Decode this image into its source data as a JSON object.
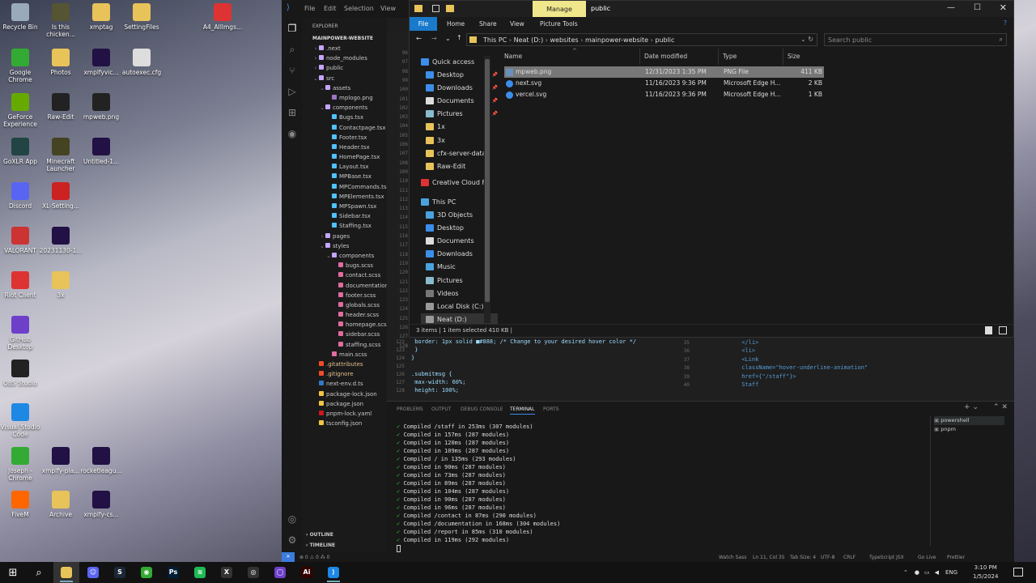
{
  "desktop": {
    "icons": [
      {
        "label": "Recycle Bin",
        "color": "#9ab"
      },
      {
        "label": "Is this chicken...",
        "color": "#553"
      },
      {
        "label": "xmptag",
        "color": "#e8c35a"
      },
      {
        "label": "SettingFiles",
        "color": "#e8c35a"
      },
      {
        "label": "A4_AllImgs...",
        "color": "#d33"
      },
      {
        "label": "Google Chrome",
        "color": "#3a3"
      },
      {
        "label": "Photos",
        "color": "#e8c35a"
      },
      {
        "label": "xmplfyvic...",
        "color": "#214"
      },
      {
        "label": "autoexec.cfg",
        "color": "#ddd"
      },
      {
        "label": "GeForce Experience",
        "color": "#6a0"
      },
      {
        "label": "Raw-Edit",
        "color": "#222"
      },
      {
        "label": "mpweb.png",
        "color": "#222"
      },
      {
        "label": "GoXLR App",
        "color": "#244"
      },
      {
        "label": "Minecraft Launcher",
        "color": "#442"
      },
      {
        "label": "Untitled-1...",
        "color": "#214"
      },
      {
        "label": "Discord",
        "color": "#5865f2"
      },
      {
        "label": "XL-Setting...",
        "color": "#c22"
      },
      {
        "label": "VALORANT",
        "color": "#c33"
      },
      {
        "label": "20231130-1...",
        "color": "#214"
      },
      {
        "label": "Riot Client",
        "color": "#d33"
      },
      {
        "label": "3x",
        "color": "#e8c35a"
      },
      {
        "label": "GitHub Desktop",
        "color": "#6e40c9"
      },
      {
        "label": "OBS Studio",
        "color": "#222"
      },
      {
        "label": "Visual Studio Code",
        "color": "#1e88e5"
      },
      {
        "label": "Joseph - Chrome",
        "color": "#3a3"
      },
      {
        "label": "xmplfy-pla...",
        "color": "#214"
      },
      {
        "label": "rocketleagu...",
        "color": "#214"
      },
      {
        "label": "FiveM",
        "color": "#f60"
      },
      {
        "label": "Archive",
        "color": "#e8c35a"
      },
      {
        "label": "xmplfy-cs...",
        "color": "#214"
      }
    ]
  },
  "vscode": {
    "menu": [
      "File",
      "Edit",
      "Selection",
      "View"
    ],
    "explorer_title": "EXPLORER",
    "root": "MAINPOWER-WEBSITE",
    "tree": [
      {
        "label": ".next",
        "depth": 1,
        "kind": "folder"
      },
      {
        "label": "node_modules",
        "depth": 1,
        "kind": "folder"
      },
      {
        "label": "public",
        "depth": 1,
        "kind": "folder"
      },
      {
        "label": "src",
        "depth": 1,
        "kind": "folder-open"
      },
      {
        "label": "assets",
        "depth": 2,
        "kind": "folder-open"
      },
      {
        "label": "mplogo.png",
        "depth": 3,
        "kind": "img"
      },
      {
        "label": "components",
        "depth": 2,
        "kind": "folder-open"
      },
      {
        "label": "Bugs.tsx",
        "depth": 3,
        "kind": "tsx"
      },
      {
        "label": "Contactpage.tsx",
        "depth": 3,
        "kind": "tsx"
      },
      {
        "label": "Footer.tsx",
        "depth": 3,
        "kind": "tsx"
      },
      {
        "label": "Header.tsx",
        "depth": 3,
        "kind": "tsx"
      },
      {
        "label": "HomePage.tsx",
        "depth": 3,
        "kind": "tsx"
      },
      {
        "label": "Layout.tsx",
        "depth": 3,
        "kind": "tsx"
      },
      {
        "label": "MPBase.tsx",
        "depth": 3,
        "kind": "tsx"
      },
      {
        "label": "MPCommands.tsx",
        "depth": 3,
        "kind": "tsx"
      },
      {
        "label": "MPElements.tsx",
        "depth": 3,
        "kind": "tsx"
      },
      {
        "label": "MPSpawn.tsx",
        "depth": 3,
        "kind": "tsx"
      },
      {
        "label": "Sidebar.tsx",
        "depth": 3,
        "kind": "tsx"
      },
      {
        "label": "Staffing.tsx",
        "depth": 3,
        "kind": "tsx"
      },
      {
        "label": "pages",
        "depth": 2,
        "kind": "folder"
      },
      {
        "label": "styles",
        "depth": 2,
        "kind": "folder-open"
      },
      {
        "label": "components",
        "depth": 3,
        "kind": "folder-open"
      },
      {
        "label": "bugs.scss",
        "depth": 4,
        "kind": "scss"
      },
      {
        "label": "contact.scss",
        "depth": 4,
        "kind": "scss"
      },
      {
        "label": "documentation.s...",
        "depth": 4,
        "kind": "scss"
      },
      {
        "label": "footer.scss",
        "depth": 4,
        "kind": "scss"
      },
      {
        "label": "globals.scss",
        "depth": 4,
        "kind": "scss"
      },
      {
        "label": "header.scss",
        "depth": 4,
        "kind": "scss"
      },
      {
        "label": "homepage.scss",
        "depth": 4,
        "kind": "scss"
      },
      {
        "label": "sidebar.scss",
        "depth": 4,
        "kind": "scss"
      },
      {
        "label": "staffing.scss",
        "depth": 4,
        "kind": "scss"
      },
      {
        "label": "main.scss",
        "depth": 3,
        "kind": "scss"
      },
      {
        "label": ".gitattributes",
        "depth": 1,
        "kind": "git"
      },
      {
        "label": ".gitignore",
        "depth": 1,
        "kind": "git"
      },
      {
        "label": "next-env.d.ts",
        "depth": 1,
        "kind": "ts"
      },
      {
        "label": "package-lock.json",
        "depth": 1,
        "kind": "json"
      },
      {
        "label": "package.json",
        "depth": 1,
        "kind": "json"
      },
      {
        "label": "pnpm-lock.yaml",
        "depth": 1,
        "kind": "yaml"
      },
      {
        "label": "tsconfig.json",
        "depth": 1,
        "kind": "json"
      }
    ],
    "outline": "OUTLINE",
    "timeline": "TIMELINE",
    "line_numbers": [
      "96",
      "97",
      "98",
      "99",
      "100",
      "101",
      "102",
      "103",
      "104",
      "105",
      "106",
      "107",
      "108",
      "109",
      "110",
      "111",
      "112",
      "113",
      "114",
      "115",
      "116",
      "117",
      "118",
      "119",
      "120",
      "121",
      "122",
      "123",
      "124",
      "125",
      "126",
      "127",
      "128"
    ],
    "code_left": [
      {
        "n": "122",
        "text": "      border: 1px solid ■#888; /* Change to your desired hover color */"
      },
      {
        "n": "123",
        "text": "    }"
      },
      {
        "n": "124",
        "text": "}"
      },
      {
        "n": "125",
        "text": ""
      },
      {
        "n": "126",
        "text": ".submitmsg {"
      },
      {
        "n": "127",
        "text": "    max-width: 60%;"
      },
      {
        "n": "128",
        "text": "    height: 100%;"
      }
    ],
    "code_right": [
      {
        "n": "34",
        "text": "          </Link>"
      },
      {
        "n": "35",
        "text": "        </li>"
      },
      {
        "n": "36",
        "text": "        <li>"
      },
      {
        "n": "37",
        "text": "          <Link"
      },
      {
        "n": "38",
        "text": "            className=\"hover-underline-animation\""
      },
      {
        "n": "39",
        "text": "            href={\"/staff\"}>"
      },
      {
        "n": "40",
        "text": "            Staff"
      }
    ],
    "panel_tabs": [
      "PROBLEMS",
      "OUTPUT",
      "DEBUG CONSOLE",
      "TERMINAL",
      "PORTS"
    ],
    "active_panel_tab": "TERMINAL",
    "terminal_lines": [
      "Compiled /staff in 253ms (307 modules)",
      "Compiled in 157ms (287 modules)",
      "Compiled in 120ms (287 modules)",
      "Compiled in 109ms (287 modules)",
      "Compiled / in 135ms (293 modules)",
      "Compiled in 90ms (287 modules)",
      "Compiled in 73ms (287 modules)",
      "Compiled in 89ms (287 modules)",
      "Compiled in 104ms (287 modules)",
      "Compiled in 90ms (287 modules)",
      "Compiled in 96ms (287 modules)",
      "Compiled /contact in 87ms (290 modules)",
      "Compiled /documentation in 168ms (304 modules)",
      "Compiled /report in 85ms (310 modules)",
      "Compiled in 119ms (292 modules)"
    ],
    "terminals": [
      "powershell",
      "pnpm"
    ],
    "status": {
      "left": "⊗ 0 ⚠ 0  ⁂ 0",
      "watch": "Watch Sass",
      "pos": "Ln 11, Col 35",
      "tab": "Tab Size: 4",
      "enc": "UTF-8",
      "eol": "CRLF",
      "lang": "TypeScript JSX",
      "golive": "Go Live",
      "prettier": "Prettier"
    }
  },
  "file_explorer": {
    "window_title": "public",
    "manage": "Manage",
    "ribbon": [
      "File",
      "Home",
      "Share",
      "View",
      "Picture Tools"
    ],
    "breadcrumb": [
      "This PC",
      "Neat (D:)",
      "websites",
      "mainpower-website",
      "public"
    ],
    "search_placeholder": "Search public",
    "nav": [
      {
        "label": "Quick access",
        "color": "#3b8eea",
        "pin": false
      },
      {
        "label": "Desktop",
        "color": "#3b8eea",
        "pin": true
      },
      {
        "label": "Downloads",
        "color": "#3b8eea",
        "pin": true
      },
      {
        "label": "Documents",
        "color": "#ddd",
        "pin": true
      },
      {
        "label": "Pictures",
        "color": "#8bc",
        "pin": true
      },
      {
        "label": "1x",
        "color": "#e8c35a",
        "pin": false
      },
      {
        "label": "3x",
        "color": "#e8c35a",
        "pin": false
      },
      {
        "label": "cfx-server-data",
        "color": "#e8c35a",
        "pin": false
      },
      {
        "label": "Raw-Edit",
        "color": "#e8c35a",
        "pin": false
      },
      {
        "label": "Creative Cloud Fil",
        "color": "#d33",
        "pin": false
      },
      {
        "label": "This PC",
        "color": "#4aa3df",
        "pin": false
      },
      {
        "label": "3D Objects",
        "color": "#4aa3df",
        "pin": false
      },
      {
        "label": "Desktop",
        "color": "#3b8eea",
        "pin": false
      },
      {
        "label": "Documents",
        "color": "#ddd",
        "pin": false
      },
      {
        "label": "Downloads",
        "color": "#3b8eea",
        "pin": false
      },
      {
        "label": "Music",
        "color": "#4aa3df",
        "pin": false
      },
      {
        "label": "Pictures",
        "color": "#8bc",
        "pin": false
      },
      {
        "label": "Videos",
        "color": "#777",
        "pin": false
      },
      {
        "label": "Local Disk (C:)",
        "color": "#999",
        "pin": false
      },
      {
        "label": "Neat (D:)",
        "color": "#999",
        "pin": false
      }
    ],
    "columns": [
      "Name",
      "Date modified",
      "Type",
      "Size"
    ],
    "files": [
      {
        "name": "mpweb.png",
        "date": "12/31/2023 1:35 PM",
        "type": "PNG File",
        "size": "411 KB"
      },
      {
        "name": "next.svg",
        "date": "11/16/2023 9:36 PM",
        "type": "Microsoft Edge H...",
        "size": "2 KB"
      },
      {
        "name": "vercel.svg",
        "date": "11/16/2023 9:36 PM",
        "type": "Microsoft Edge H...",
        "size": "1 KB"
      }
    ],
    "status": "3 items  |  1 item selected  410 KB  |"
  },
  "taskbar": {
    "apps": [
      {
        "name": "file-explorer",
        "color": "#e8c35a",
        "glyph": ""
      },
      {
        "name": "discord",
        "color": "#5865f2",
        "glyph": "☺"
      },
      {
        "name": "steam",
        "color": "#1b2838",
        "glyph": "S"
      },
      {
        "name": "chrome",
        "color": "#3a3",
        "glyph": "◉"
      },
      {
        "name": "photoshop",
        "color": "#001e36",
        "glyph": "Ps"
      },
      {
        "name": "spotify",
        "color": "#1db954",
        "glyph": "≋"
      },
      {
        "name": "goxlr",
        "color": "#333",
        "glyph": "X"
      },
      {
        "name": "obs",
        "color": "#333",
        "glyph": "◎"
      },
      {
        "name": "github",
        "color": "#6e40c9",
        "glyph": "◯"
      },
      {
        "name": "illustrator",
        "color": "#330000",
        "glyph": "Ai"
      },
      {
        "name": "vscode",
        "color": "#1e88e5",
        "glyph": "⟩"
      }
    ],
    "lang": "ENG",
    "time": "3:10 PM",
    "date": "1/5/2024"
  }
}
